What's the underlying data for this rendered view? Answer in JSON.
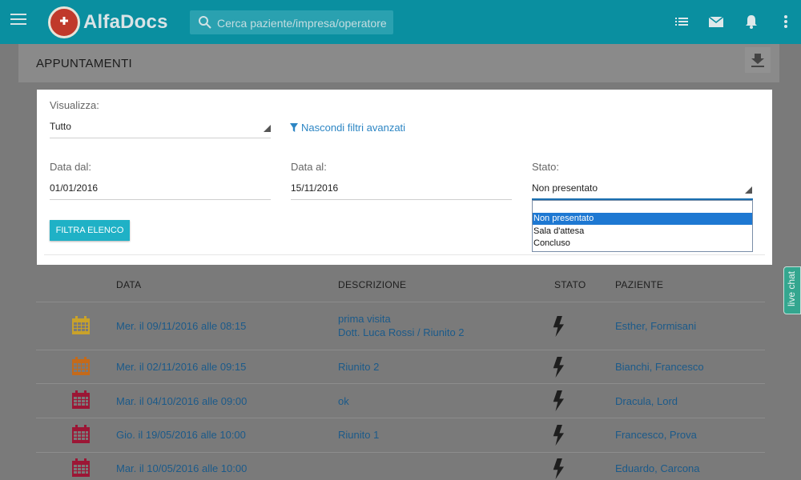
{
  "topbar": {
    "brand": "AlfaDocs",
    "search_placeholder": "Cerca paziente/impresa/operatore",
    "icons": [
      "menu-icon",
      "list-icon",
      "mail-icon",
      "bell-icon",
      "more-vert-icon"
    ],
    "color": "#0a8fa0"
  },
  "page": {
    "title": "APPUNTAMENTI"
  },
  "filters": {
    "visualizza_label": "Visualizza:",
    "visualizza_value": "Tutto",
    "advanced_link": "Nascondi filtri avanzati",
    "data_dal_label": "Data dal:",
    "data_dal_value": "01/01/2016",
    "data_al_label": "Data al:",
    "data_al_value": "15/11/2016",
    "stato_label": "Stato:",
    "stato_value": "Non presentato",
    "stato_options": [
      "Non presentato",
      "Sala d'attesa",
      "Concluso"
    ],
    "button": "FILTRA ELENCO"
  },
  "table": {
    "headers": [
      "DATA",
      "DESCRIZIONE",
      "STATO",
      "PAZIENTE"
    ],
    "rows": [
      {
        "icon_color": "#c9a22a",
        "date": "Mer. il 09/11/2016 alle 08:15",
        "desc1": "prima visita",
        "desc2": "Dott. Luca Rossi / Riunito 2",
        "patient": "Esther, Formisani"
      },
      {
        "icon_color": "#c46a1a",
        "date": "Mer. il 02/11/2016 alle 09:15",
        "desc1": "Riunito 2",
        "desc2": "",
        "patient": "Bianchi, Francesco"
      },
      {
        "icon_color": "#9c1635",
        "date": "Mar. il 04/10/2016 alle 09:00",
        "desc1": "ok",
        "desc2": "",
        "patient": "Dracula, Lord"
      },
      {
        "icon_color": "#9c1635",
        "date": "Gio. il 19/05/2016 alle 10:00",
        "desc1": "Riunito 1",
        "desc2": "",
        "patient": "Francesco, Prova"
      },
      {
        "icon_color": "#9c1635",
        "date": "Mar. il 10/05/2016 alle 10:00",
        "desc1": "",
        "desc2": "",
        "patient": "Eduardo, Carcona"
      }
    ]
  },
  "livechat": "live chat"
}
